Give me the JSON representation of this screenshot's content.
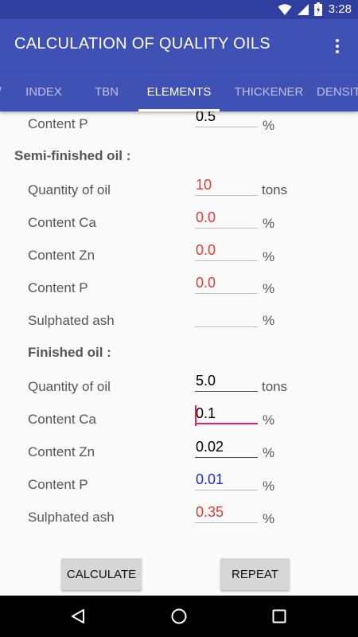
{
  "status_bar": {
    "time": "3:28"
  },
  "app_bar": {
    "title": "CALCULATION OF QUALITY OILS"
  },
  "tabs": [
    {
      "label": "INDEX",
      "active": false
    },
    {
      "label": "TBN",
      "active": false
    },
    {
      "label": "ELEMENTS",
      "active": true
    },
    {
      "label": "THICKENER",
      "active": false
    },
    {
      "label": "DENSITY",
      "active": false
    }
  ],
  "top_row": {
    "label": "Content P",
    "value": "0.5",
    "unit": "%",
    "color": "#000000"
  },
  "semi_finished": {
    "heading": "Semi-finished oil :",
    "rows": [
      {
        "label": "Quantity of oil",
        "value": "10",
        "unit": "tons",
        "color": "#e53935"
      },
      {
        "label": "Content Ca",
        "value": "0.0",
        "unit": "%",
        "color": "#e53935"
      },
      {
        "label": "Content Zn",
        "value": "0.0",
        "unit": "%",
        "color": "#e53935"
      },
      {
        "label": "Content P",
        "value": "0.0",
        "unit": "%",
        "color": "#e53935"
      },
      {
        "label": "Sulphated ash",
        "value": "",
        "unit": "%",
        "color": "#e53935"
      }
    ]
  },
  "finished": {
    "heading": "Finished oil :",
    "rows": [
      {
        "label": "Quantity of oil",
        "value": "5.0",
        "unit": "tons",
        "color": "#000000"
      },
      {
        "label": "Content Ca",
        "value": "0.1",
        "unit": "%",
        "color": "#000000"
      },
      {
        "label": "Content Zn",
        "value": "0.02",
        "unit": "%",
        "color": "#000000"
      },
      {
        "label": "Content P",
        "value": "0.01",
        "unit": "%",
        "color": "#1e2bd6"
      },
      {
        "label": "Sulphated ash",
        "value": "0.35",
        "unit": "%",
        "color": "#e53935"
      }
    ]
  },
  "buttons": {
    "calculate": "CALCULATE",
    "repeat": "REPEAT"
  },
  "colors": {
    "primary": "#3f51b5",
    "primary_dark": "#303f9f",
    "accent": "#e91e63"
  }
}
